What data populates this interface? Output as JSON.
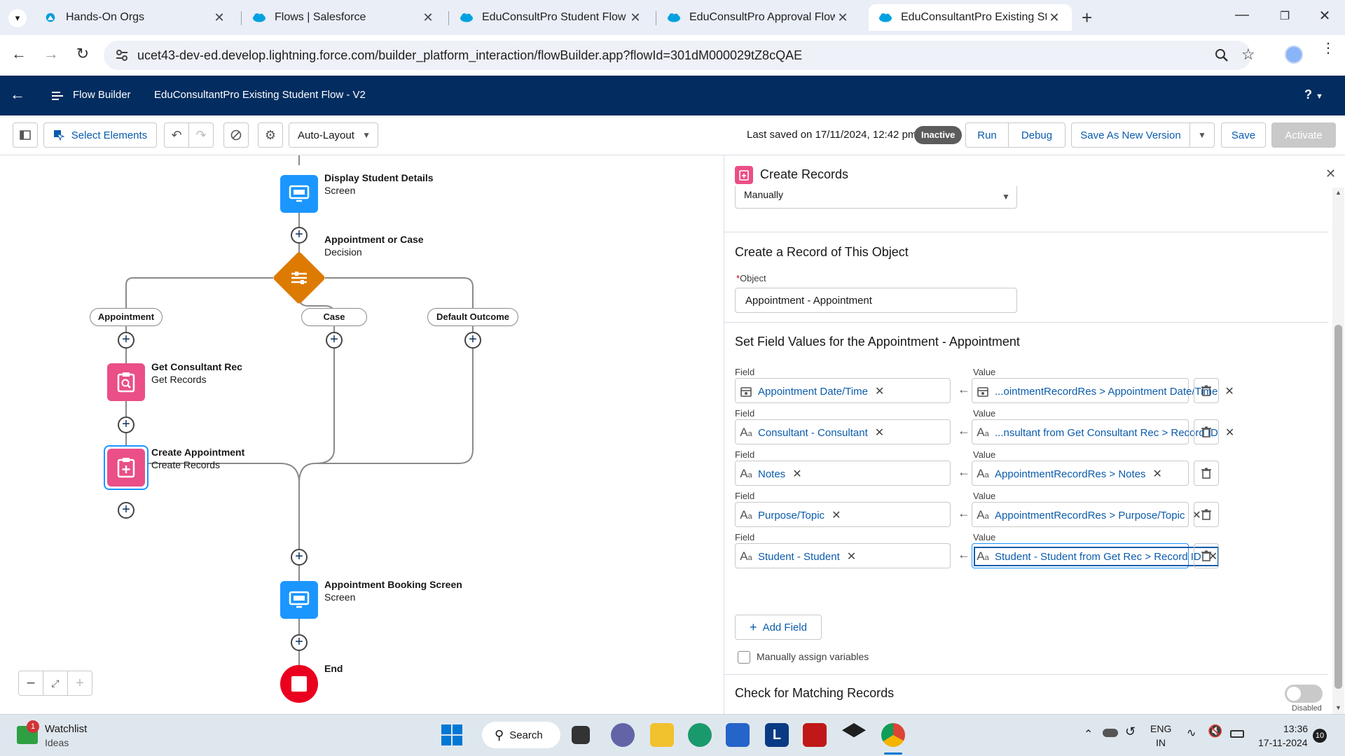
{
  "browser": {
    "tabs": [
      {
        "title": "Hands-On Orgs"
      },
      {
        "title": "Flows | Salesforce"
      },
      {
        "title": "EduConsultPro Student Flow - V"
      },
      {
        "title": "EduConsultPro Approval Flow -"
      },
      {
        "title": "EduConsultantPro Existing Stud"
      }
    ],
    "new_tab": "+",
    "url": "ucet43-dev-ed.develop.lightning.force.com/builder_platform_interaction/flowBuilder.app?flowId=301dM000029tZ8cQAE"
  },
  "app_header": {
    "app_name": "Flow Builder",
    "flow_title": "EduConsultantPro Existing Student Flow - V2",
    "help": "?"
  },
  "toolbar": {
    "select_elements": "Select Elements",
    "layout_option": "Auto-Layout",
    "last_saved": "Last saved on 17/11/2024, 12:42 pm",
    "status_badge": "Inactive",
    "run": "Run",
    "debug": "Debug",
    "save_as_new_version": "Save As New Version",
    "save": "Save",
    "activate": "Activate"
  },
  "canvas": {
    "nodes": [
      {
        "title": "Display Student Details",
        "type": "Screen"
      },
      {
        "title": "Appointment or Case",
        "type": "Decision"
      },
      {
        "title": "Get Consultant Rec",
        "type": "Get Records"
      },
      {
        "title": "Create Appointment",
        "type": "Create Records"
      },
      {
        "title": "Appointment Booking Screen",
        "type": "Screen"
      },
      {
        "title": "End",
        "type": ""
      }
    ],
    "outcomes": [
      "Appointment",
      "Case",
      "Default Outcome"
    ]
  },
  "panel": {
    "title": "Create Records",
    "how_to_set_value": "Manually",
    "object_section_title": "Create a Record of This Object",
    "object_label": "Object",
    "object_value": "Appointment - Appointment",
    "set_fields_title": "Set Field Values for the Appointment - Appointment",
    "field_label": "Field",
    "value_label": "Value",
    "rows": [
      {
        "field": "Appointment Date/Time",
        "value": "...ointmentRecordRes > Appointment Date/Time",
        "icon": "calendar-icon"
      },
      {
        "field": "Consultant - Consultant",
        "value": "...nsultant from Get Consultant Rec > Record ID",
        "icon": "text-icon"
      },
      {
        "field": "Notes",
        "value": "AppointmentRecordRes > Notes",
        "icon": "text-icon"
      },
      {
        "field": "Purpose/Topic",
        "value": "AppointmentRecordRes > Purpose/Topic",
        "icon": "text-icon"
      },
      {
        "field": "Student - Student",
        "value": "Student - Student from Get Rec > Record ID",
        "icon": "text-icon"
      }
    ],
    "add_field": "Add Field",
    "manual_vars": "Manually assign variables",
    "check_matching": "Check for Matching Records",
    "toggle_state": "Disabled"
  },
  "taskbar": {
    "widget_title": "Watchlist",
    "widget_sub": "Ideas",
    "widget_badge": "1",
    "search": "Search",
    "lang1": "ENG",
    "lang2": "IN",
    "time": "13:36",
    "date": "17-11-2024",
    "notif": "10"
  }
}
